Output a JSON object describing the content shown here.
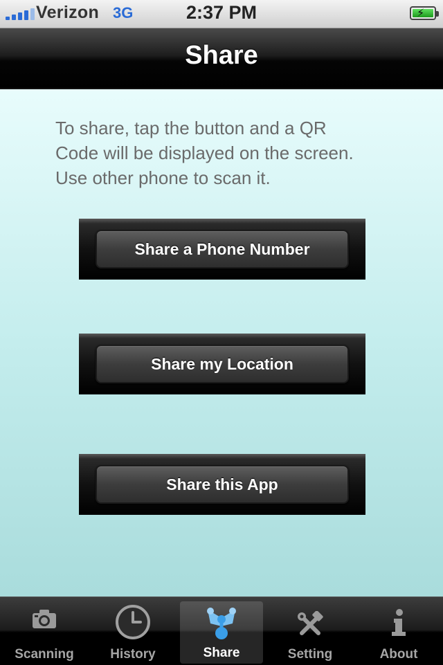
{
  "status_bar": {
    "carrier": "Verizon",
    "network": "3G",
    "time": "2:37 PM",
    "battery_icon": "battery-charging-icon",
    "signal_icon": "signal-bars-icon"
  },
  "nav": {
    "title": "Share"
  },
  "content": {
    "instructions": "To share, tap the button and a QR\nCode will be displayed on the screen.\nUse other phone to scan it.",
    "buttons": [
      {
        "label": "Share a Phone Number"
      },
      {
        "label": "Share my Location"
      },
      {
        "label": "Share this App"
      }
    ]
  },
  "tabs": [
    {
      "label": "Scanning",
      "icon": "camera-icon",
      "active": false
    },
    {
      "label": "History",
      "icon": "clock-icon",
      "active": false
    },
    {
      "label": "Share",
      "icon": "share-network-icon",
      "active": true
    },
    {
      "label": "Setting",
      "icon": "tools-icon",
      "active": false
    },
    {
      "label": "About",
      "icon": "info-icon",
      "active": false
    }
  ],
  "colors": {
    "accent_blue": "#2a6bd6",
    "tab_active_icon": "#3a9ee8",
    "tab_inactive": "#a6a6a6"
  }
}
